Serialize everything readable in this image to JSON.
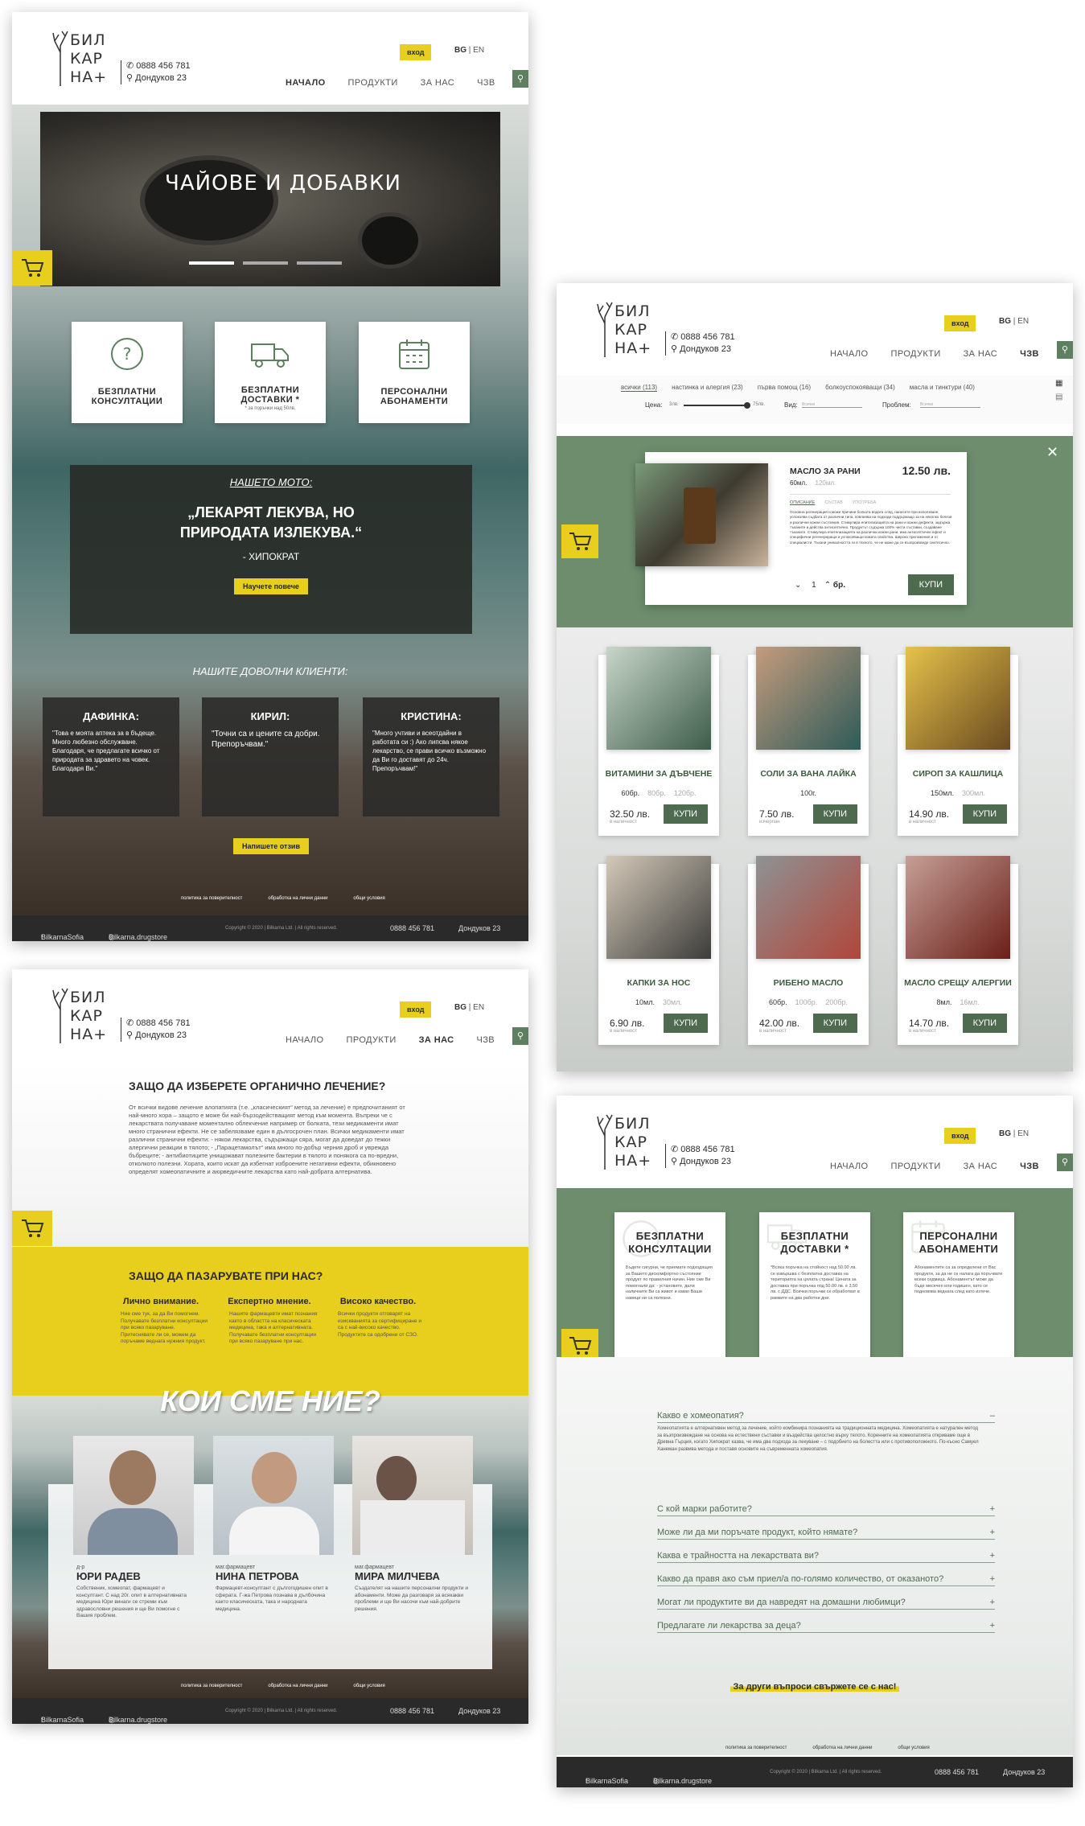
{
  "brand": {
    "logo": "БИЛ КАР НА+"
  },
  "header": {
    "phone": "0888 456 781",
    "address": "Дондуков 23",
    "login": "вход",
    "lang_bg": "BG",
    "lang_sep": " | ",
    "lang_en": "EN",
    "nav": [
      "НАЧАЛО",
      "ПРОДУКТИ",
      "ЗА НАС",
      "ЧЗВ"
    ]
  },
  "home": {
    "hero_title": "ЧАЙОВЕ И ДОБАВКИ",
    "features": [
      "БЕЗПЛАТНИ КОНСУЛТАЦИИ",
      "БЕЗПЛАТНИ ДОСТАВКИ *",
      "ПЕРСОНАЛНИ АБОНАМЕНТИ"
    ],
    "delivery_note": "* за поръчки над 50лв.",
    "motto_title": "НАШЕТО МОТО:",
    "motto_quote": "„ЛЕКАРЯТ ЛЕКУВА, НО ПРИРОДАТА ИЗЛЕКУВА.“",
    "motto_author": "- ХИПОКРАТ",
    "motto_btn": "Научете повече",
    "clients_title": "НАШИТЕ ДОВОЛНИ КЛИЕНТИ:",
    "reviews": [
      {
        "name": "ДАФИНКА:",
        "text": "\"Това е моята аптека за в бъдеще. Много любезно обслужване. Благодаря, че предлагате всичко от природата за здравето на човек. Благодаря Ви.\""
      },
      {
        "name": "КИРИЛ:",
        "text": "\"Точни са и цените са добри. Препоръчвам.\""
      },
      {
        "name": "КРИСТИНА:",
        "text": "\"Много учтиви и всеотдайни в работата си :) Ако липсва някое лекарство, се прави всичко възможно да Ви го доставят до 24ч. Препоръчвам!\""
      }
    ],
    "review_btn": "Напишете отзив"
  },
  "footer": {
    "facebook": "BilkarnaSofia",
    "instagram": "Bilkarna.drugstore",
    "copyright": "Copyright © 2020 | Bilkarna Ltd. | All rights reserved.",
    "links": [
      "политика за поверителност",
      "обработка на лични данни",
      "общи условия"
    ]
  },
  "products": {
    "filters": [
      "всички (113)",
      "настинка и алергия (23)",
      "първа помощ (16)",
      "болкоуспокояващи (34)",
      "масла и тинктури (40)"
    ],
    "price_label": "Цена:",
    "price_min": "3лв.",
    "price_max": "75лв.",
    "type_label": "Вид:",
    "type_ph": "Всички",
    "problem_label": "Проблем:",
    "problem_ph": "Всички",
    "detail": {
      "name": "МАСЛО ЗА РАНИ",
      "price": "12.50 лв.",
      "size": "60мл.",
      "size_alt": "120мл.",
      "tabs": [
        "ОПИСАНИЕ",
        "СЪСТАВ",
        "УПОТРЕБА"
      ],
      "desc": "Основна регенерация и може причини болката водата след, нанесете при използване, успокоява съдбата от различни типа, повлиява на подходи поддържащо за на няколко белези и различни кожни състояния. Стимулира епителизацията на рани и кожни дефекти, задържа тъканите и действа антисептично. Продуктът съдържа 100% чисти съставки, създаване тъканите. Стимулира епителизацията на различни кожни рани, има антисептичен ефект и специфични регенериращи и успокояващи кожата свойства. Широко приложение и от специалисти. Тъкани уникалността ги в тяхното, че не може да се възпроизведе синтетично.",
      "qty": "1",
      "qty_unit": "бр.",
      "buy": "КУПИ"
    },
    "items": [
      {
        "name": "ВИТАМИНИ ЗА ДЪВЧЕНЕ",
        "size": "60бр.",
        "alts": [
          "80бр.",
          "120бр."
        ],
        "price": "32.50 лв.",
        "stock": "в наличност"
      },
      {
        "name": "СОЛИ ЗА ВАНА ЛАЙКА",
        "size": "100г.",
        "alts": [],
        "price": "7.50 лв.",
        "stock": "изчерпан"
      },
      {
        "name": "СИРОП ЗА КАШЛИЦА",
        "size": "150мл.",
        "alts": [
          "300мл."
        ],
        "price": "14.90 лв.",
        "stock": "в наличност"
      },
      {
        "name": "КАПКИ ЗА НОС",
        "size": "10мл.",
        "alts": [
          "30мл."
        ],
        "price": "6.90 лв.",
        "stock": "в наличност"
      },
      {
        "name": "РИБЕНО МАСЛО",
        "size": "60бр.",
        "alts": [
          "100бр.",
          "200бр."
        ],
        "price": "42.00 лв.",
        "stock": "в наличност"
      },
      {
        "name": "МАСЛО СРЕЩУ АЛЕРГИИ",
        "size": "8мл.",
        "alts": [
          "16мл."
        ],
        "price": "14.70 лв.",
        "stock": "в наличност"
      }
    ]
  },
  "about": {
    "why_title": "ЗАЩО ДА ИЗБЕРЕТЕ ОРГАНИЧНО ЛЕЧЕНИЕ?",
    "why_text": "От всички видове лечение алопатията (т.е. „класическият“ метод за лечение) е предпочитаният от най-много хора – защото е може би най-бързодействащият метод към момента. Въпреки че с лекарствата получаване моментално облекчение например от болката, тези медикаменти имат много странични ефекти. Не се забелязваме един в дългосрочен план. Всички медикаменти имат различни странични ефекти: - някои лекарства, съдържащи сяра, могат да доведат до тежки алергични реакции в тялото; - „Парацетамолът“ има много по-добър черния дроб и уврежда бъбреците; - антибиотиците унищожават полезните бактерии в тялото и понякога са по-вредни, отколкото полезни. Хората, които искат да избегнат изброените негативни ефекти, обикновено определят хомеопатичните и аюрведичните лекарства като най-добрата алтернатива.",
    "shop_title": "ЗАЩО ДА ПАЗАРУВАТЕ ПРИ НАС?",
    "cols": [
      {
        "title": "Лично внимание.",
        "text": "Ние сме тук, за да Ви помогнем. Получавате безплатни консултации при всяко пазаруване. Притеснявате ли се, можем да поръчаме веднага нужния продукт."
      },
      {
        "title": "Експертно мнение.",
        "text": "Нашите фармацевти имат познания както в областта на класическата медицина, така и алтернативната. Получавате безплатни консултации при всяко пазаруване при нас."
      },
      {
        "title": "Високо качество.",
        "text": "Всички продукти отговарят на изискванията за сертифициране и са с най-високо качество. Продуктите са одобрени от СЗО."
      }
    ],
    "team_title": "КОИ СМЕ НИЕ?",
    "team": [
      {
        "role": "д-р",
        "name": "ЮРИ РАДЕВ",
        "bio": "Собственик, хомеопат, фармацевт и консултант. С над 20г. опит в алтернативната медицина Юри винаги се стреми към здравословни решения и ще Ви помогне с Вашия проблем."
      },
      {
        "role": "маг.фармацевт",
        "name": "НИНА ПЕТРОВА",
        "bio": "Фармацевт-консултант с дългогодишен опит в сферата. Г-жа Петрова познава в дълбочина както класическата, така и народната медицина."
      },
      {
        "role": "маг.фармацевт",
        "name": "МИРА МИЛЧЕВА",
        "bio": "Създателят на нашите персонални продукти и абонаменти. Може да разговаря за всякакви проблеми и ще Ви насочи към най-добрите решения."
      }
    ]
  },
  "faq": {
    "cards": [
      {
        "title": "БЕЗПЛАТНИ КОНСУЛТАЦИИ",
        "text": "Бъдете сигурни, че приемате подходящия за Вашето дискомфортно състояние продукт по правилния начин. Ние сме Ви помогнали да: - установите, дали наличните Ви са живот и какво Ваши навици ни са полезни."
      },
      {
        "title": "БЕЗПЛАТНИ ДОСТАВКИ *",
        "text": "*Всяка поръчка на стойност над 50.00 лв. се извършва с безплатна доставка на територията на цялата страна! Цената за доставка при поръчка под 50.00 лв. е 3.50 лв. с ДДС. Всички поръчки се обработват в рамките на два работни дни."
      },
      {
        "title": "ПЕРСОНАЛНИ АБОНАМЕНТИ",
        "text": "Абонаментите са за определени от Вас продукти, за да не се налага да поръчвате всеки седмица. Абонаментът може да бъде месечен или годишен, като се подновява веднага след като изтече."
      }
    ],
    "questions": [
      "Какво е хомеопатия?",
      "С кой марки работите?",
      "Може ли да ми поръчате продукт, който нямате?",
      "Каква е трайността на лекарствата ви?",
      "Какво да правя ако съм приел/а по-голямо количество, от оказаното?",
      "Могат ли продуктите ви да навредят на домашни любимци?",
      "Предлагате ли лекарства за деца?"
    ],
    "answer": "Хомеопатията е алтернативен метод за лечение, който комбинира познанията на традиционната медицина. Хомеопатията е натурален метод за възпроизвеждане на основа на естествени съставки и въздейства целостно върху тялото. Коренните на хомеопатията откриваме още в Древна Гърция, когато Хипократ казва, че има два подхода за лекуване – с подобието на болестта или с противоположното. По-късно Самуел Ханеман развива метода и поставя основите на съвременната хомеопатия.",
    "cta": "За други въпроси свържете се с нас!"
  },
  "colors": {
    "accent": "#e8cf1d",
    "green": "#4e6b4f",
    "dark": "#2a2a2a"
  }
}
